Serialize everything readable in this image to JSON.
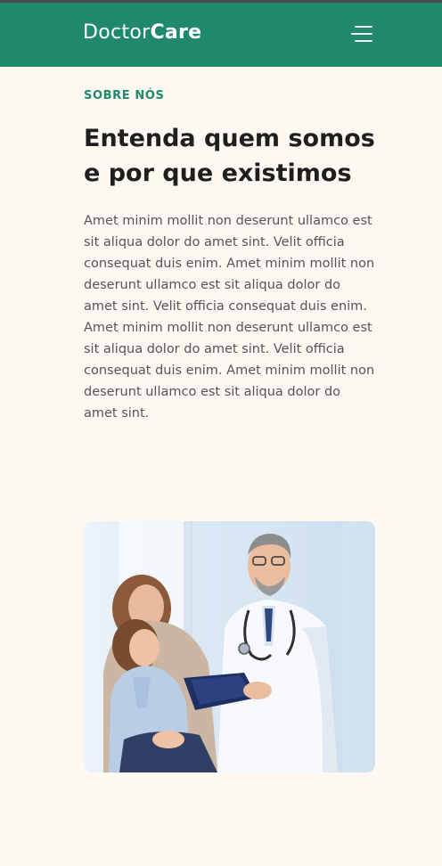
{
  "header": {
    "logo": {
      "part1": "Doctor",
      "part2": "Care"
    },
    "background": "#1e8a6b",
    "menu_icon": "hamburger-menu-icon"
  },
  "about": {
    "eyebrow": "SOBRE NÓS",
    "title": "Entenda quem somos e por que existimos",
    "body": "Amet minim mollit non deserunt ullamco est sit aliqua dolor do amet sint. Velit officia consequat duis enim. Amet minim mollit non deserunt ullamco est sit aliqua dolor do amet sint. Velit officia consequat duis enim. Amet minim mollit non deserunt ullamco est sit aliqua dolor do amet sint. Velit officia consequat duis enim. Amet minim mollit non deserunt ullamco est sit aliqua dolor do amet sint.",
    "image": "doctor-with-mother-and-daughter-photo"
  },
  "colors": {
    "accent": "#1e8a6b",
    "page_background": "#fdf8f1",
    "heading": "#1f1f1f",
    "text": "#555555"
  }
}
